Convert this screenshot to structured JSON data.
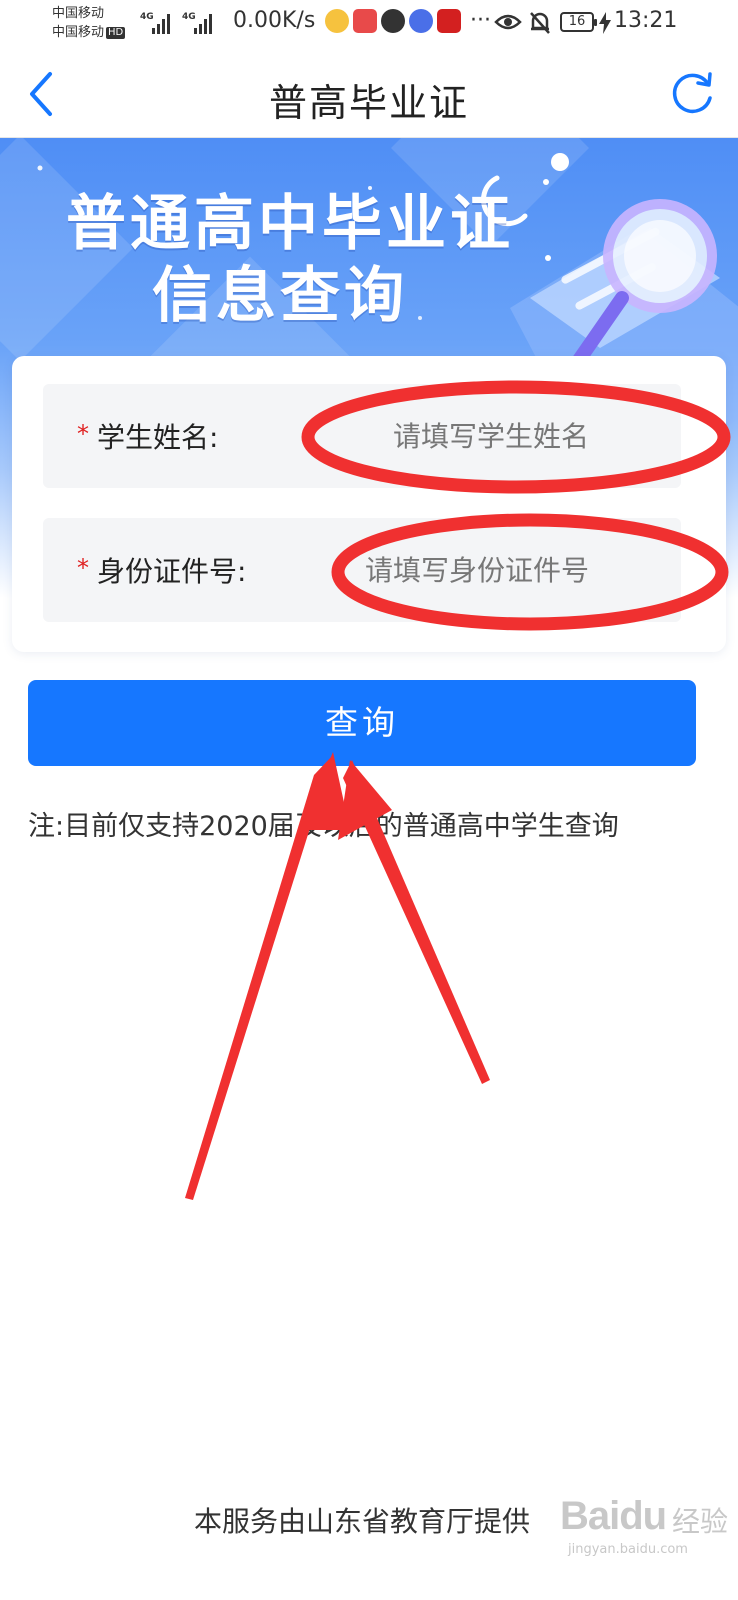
{
  "status_bar": {
    "carrier_1": "中国移动",
    "carrier_2": "中国移动",
    "hd_badge": "HD",
    "network_1": "4G",
    "network_2": "4G",
    "net_speed": "0.00K/s",
    "more": "···",
    "battery": "16",
    "time": "13:21"
  },
  "nav": {
    "title": "普高毕业证"
  },
  "banner": {
    "title_line1": "普通高中毕业证",
    "title_line2": "信息查询"
  },
  "form": {
    "name_required_mark": "*",
    "name_label": "学生姓名:",
    "name_placeholder": "请填写学生姓名",
    "name_value": "",
    "id_required_mark": "*",
    "id_label": "身份证件号:",
    "id_placeholder": "请填写身份证件号",
    "id_value": ""
  },
  "query_button": "查询",
  "note": "注:目前仅支持2020届及以后的普通高中学生查询",
  "footer": "本服务由山东省教育厅提供",
  "watermark": {
    "brand": "Baidu",
    "suffix": "经验",
    "url": "jingyan.baidu.com"
  },
  "colors": {
    "primary": "#1677ff",
    "required": "#e02020",
    "annotation": "#f03030",
    "banner": "#4f8ef5"
  },
  "icons": [
    "back-arrow-icon",
    "refresh-icon",
    "magnifier-illustration"
  ]
}
